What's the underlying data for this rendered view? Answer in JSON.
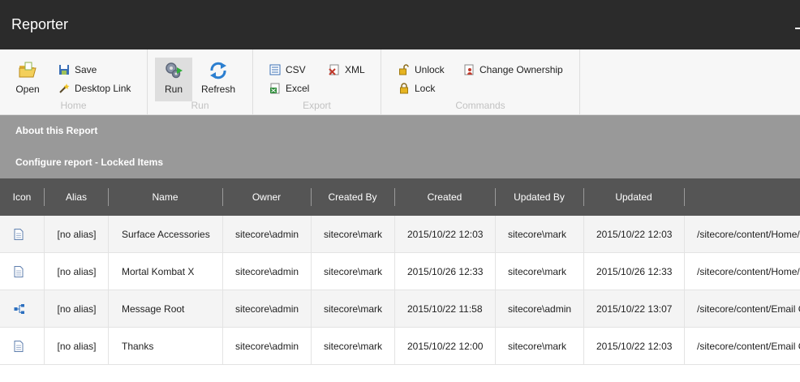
{
  "app": {
    "title": "Reporter"
  },
  "ribbon": {
    "home": {
      "label": "Home",
      "open": "Open",
      "save": "Save",
      "desktop_link": "Desktop Link"
    },
    "run": {
      "label": "Run",
      "run": "Run",
      "refresh": "Refresh"
    },
    "export": {
      "label": "Export",
      "csv": "CSV",
      "xml": "XML",
      "excel": "Excel"
    },
    "commands": {
      "label": "Commands",
      "unlock": "Unlock",
      "change_ownership": "Change Ownership",
      "lock": "Lock"
    }
  },
  "panels": {
    "about": "About this Report",
    "configure": "Configure report - Locked Items"
  },
  "table": {
    "columns": [
      "Icon",
      "Alias",
      "Name",
      "Owner",
      "Created By",
      "Created",
      "Updated By",
      "Updated",
      ""
    ],
    "rows": [
      {
        "icon": "document-icon",
        "alias": "[no alias]",
        "name": "Surface Accessories",
        "owner": "sitecore\\admin",
        "created_by": "sitecore\\mark",
        "created": "2015/10/22 12:03",
        "updated_by": "sitecore\\mark",
        "updated": "2015/10/22 12:03",
        "path": "/sitecore/content/Home/"
      },
      {
        "icon": "document-icon",
        "alias": "[no alias]",
        "name": "Mortal Kombat X",
        "owner": "sitecore\\admin",
        "created_by": "sitecore\\mark",
        "created": "2015/10/26 12:33",
        "updated_by": "sitecore\\mark",
        "updated": "2015/10/26 12:33",
        "path": "/sitecore/content/Home/"
      },
      {
        "icon": "hierarchy-icon",
        "alias": "[no alias]",
        "name": "Message Root",
        "owner": "sitecore\\admin",
        "created_by": "sitecore\\mark",
        "created": "2015/10/22 11:58",
        "updated_by": "sitecore\\admin",
        "updated": "2015/10/22 13:07",
        "path": "/sitecore/content/Email C"
      },
      {
        "icon": "document-icon",
        "alias": "[no alias]",
        "name": "Thanks",
        "owner": "sitecore\\admin",
        "created_by": "sitecore\\mark",
        "created": "2015/10/22 12:00",
        "updated_by": "sitecore\\mark",
        "updated": "2015/10/22 12:03",
        "path": "/sitecore/content/Email C"
      }
    ]
  },
  "colors": {
    "titlebar": "#2b2b2b",
    "panel": "#999999",
    "header": "#555555",
    "row_alt": "#f4f4f4"
  }
}
